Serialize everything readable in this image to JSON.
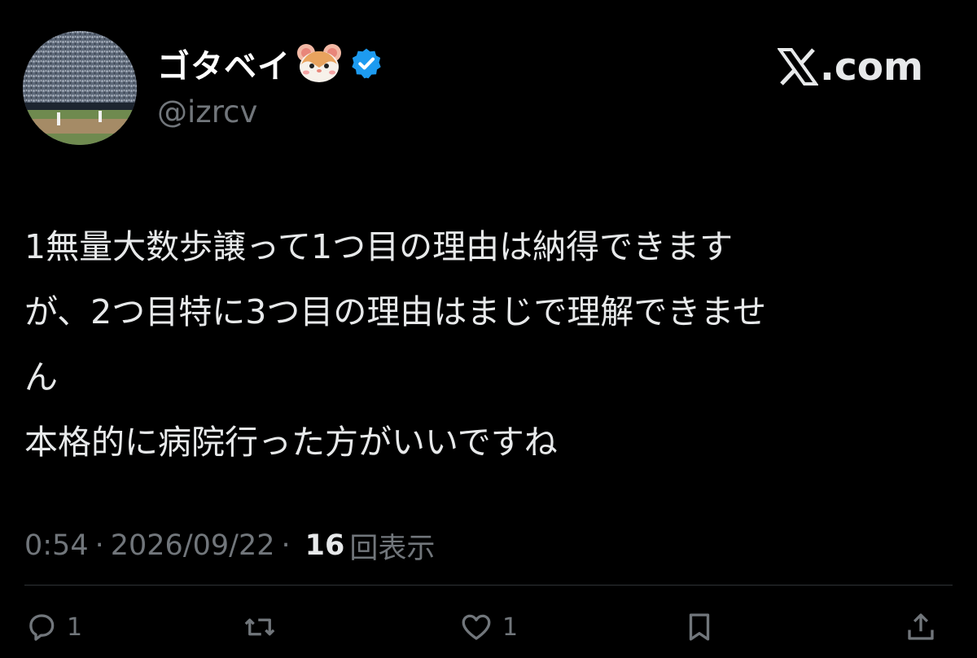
{
  "user": {
    "display_name": "ゴタベイ",
    "name_emoji": "hamster-face-icon",
    "verified": true,
    "handle": "@izrcv",
    "avatar": "baseball-stadium-photo"
  },
  "brand": {
    "logo": "x-logo-icon",
    "text": ".com"
  },
  "tweet": {
    "lines": [
      "1無量大数歩譲って1つ目の理由は納得できます",
      "が、2つ目特に3つ目の理由はまじで理解できませ",
      "ん",
      "本格的に病院行った方がいいですね"
    ]
  },
  "meta": {
    "time": "0:54",
    "separator": "·",
    "date": "2026/09/22",
    "views_count": "16",
    "views_label": "回表示"
  },
  "actions": {
    "reply_count": "1",
    "repost_count": "",
    "like_count": "1"
  },
  "colors": {
    "background": "#000000",
    "text": "#e7e9ea",
    "muted": "#71767b",
    "verified": "#1d9bf0"
  }
}
